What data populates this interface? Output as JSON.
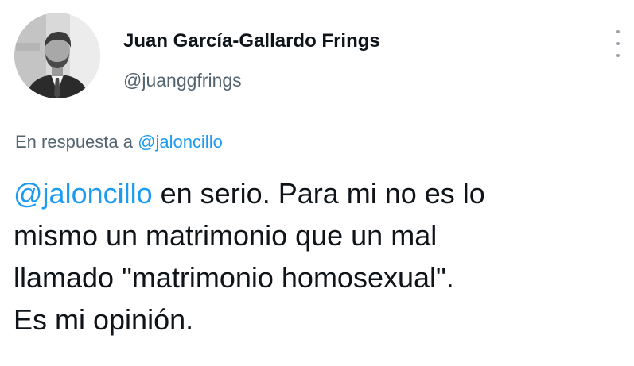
{
  "user": {
    "display_name": "Juan García-Gallardo Frings",
    "handle": "@juanggfrings"
  },
  "reply": {
    "prefix": "En respuesta a ",
    "mention": "@jaloncillo"
  },
  "tweet": {
    "mention": "@jaloncillo",
    "line1_rest": " en serio. Para mi no es lo",
    "line2": "mismo un matrimonio que un mal",
    "line3": "llamado \"matrimonio homosexual\".",
    "line4": "Es mi opinión."
  },
  "icons": {
    "more": "more-vertical-icon"
  },
  "colors": {
    "link": "#1d9bf0",
    "secondary_text": "#536471",
    "primary_text": "#0f1419"
  }
}
